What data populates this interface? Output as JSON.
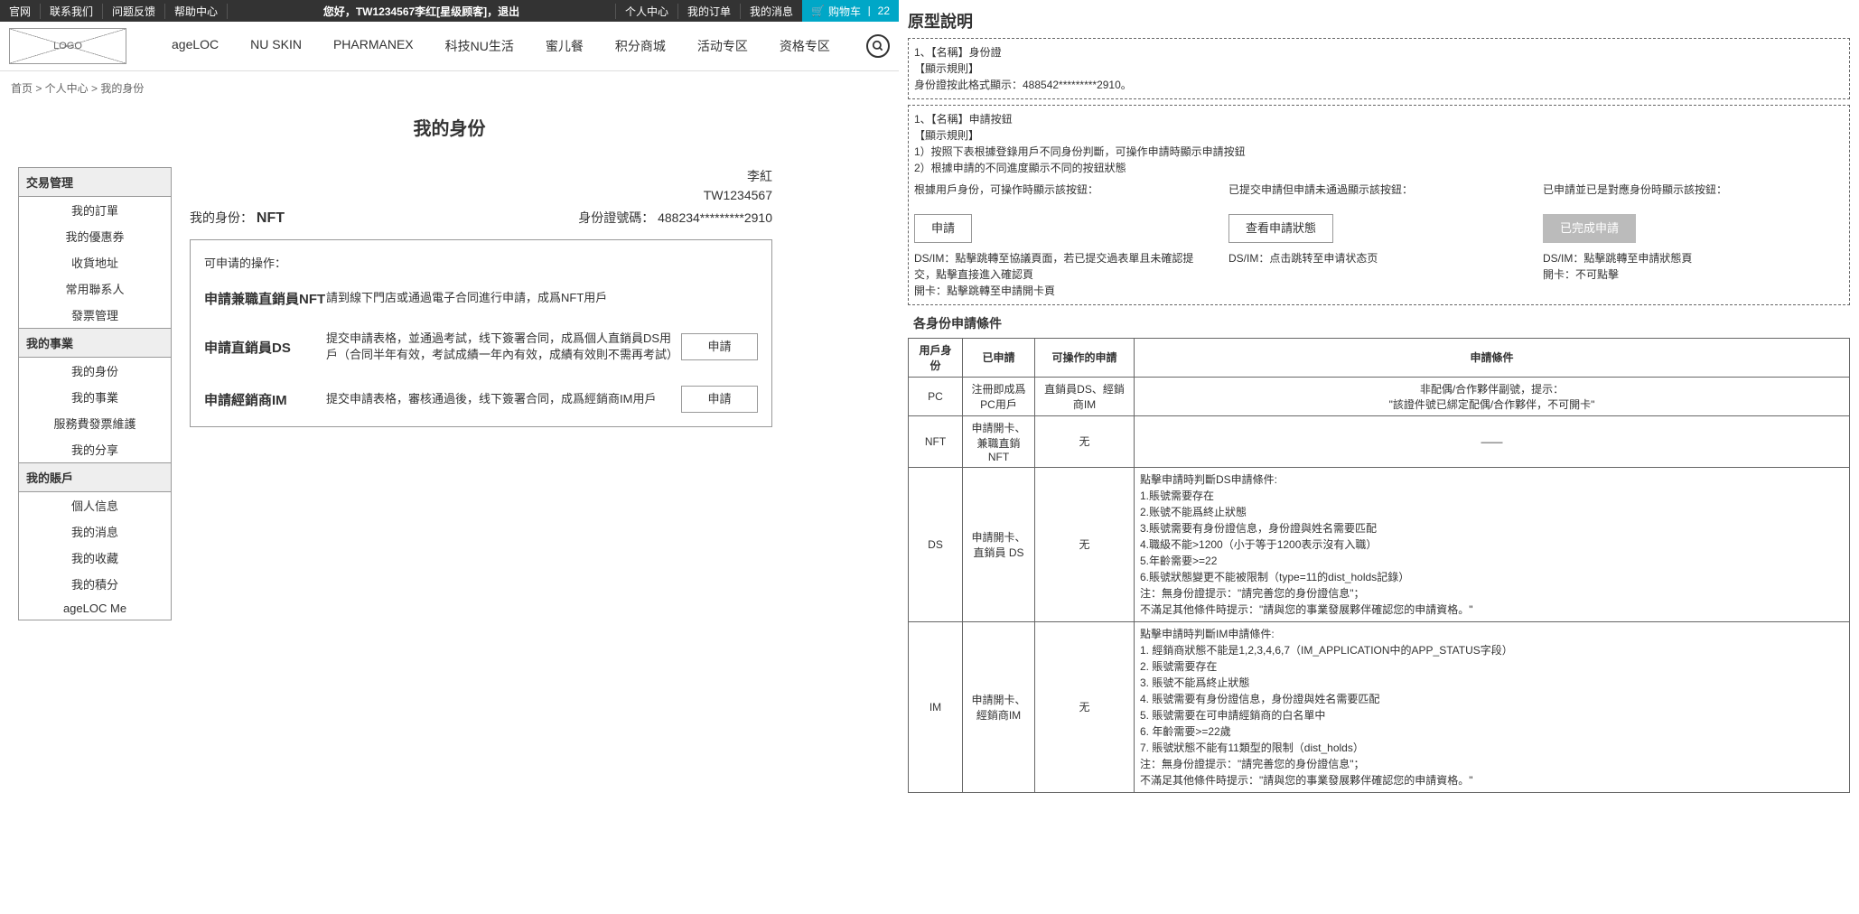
{
  "topbar": {
    "links": [
      "官网",
      "联系我们",
      "问题反馈",
      "帮助中心"
    ],
    "welcome": "您好，TW1234567李红[星级顾客]，退出",
    "right": [
      "个人中心",
      "我的订单",
      "我的消息"
    ],
    "cart": "购物车",
    "cart_count": "22"
  },
  "nav": {
    "logo": "LOGO",
    "items": [
      "ageLOC",
      "NU SKIN",
      "PHARMANEX",
      "科技NU生活",
      "蜜儿餐",
      "积分商城",
      "活动专区",
      "资格专区"
    ]
  },
  "breadcrumb": "首页 > 个人中心 > 我的身份",
  "page_title": "我的身份",
  "sidebar": {
    "g1": {
      "title": "交易管理",
      "items": [
        "我的訂單",
        "我的優惠券",
        "收貨地址",
        "常用聯系人",
        "發票管理"
      ]
    },
    "g2": {
      "title": "我的事業",
      "items": [
        "我的身份",
        "我的事業",
        "服務費發票維護",
        "我的分享"
      ]
    },
    "g3": {
      "title": "我的賬戶",
      "items": [
        "個人信息",
        "我的消息",
        "我的收藏",
        "我的積分",
        "ageLOC Me"
      ]
    }
  },
  "user": {
    "name": "李紅",
    "id": "TW1234567"
  },
  "identity": {
    "label": "我的身份：",
    "value": "NFT",
    "idcard_label": "身份證號碼：",
    "idcard": "488234*********2910"
  },
  "ops": {
    "title": "可申请的操作：",
    "rows": [
      {
        "name": "申請兼職直銷員NFT",
        "desc": "請到線下門店或通過電子合同進行申請，成爲NFT用戶",
        "btn": ""
      },
      {
        "name": "申請直銷員DS",
        "desc": "提交申請表格，並通過考試，线下簽署合同，成爲個人直銷員DS用戶（合同半年有效，考試成績一年內有效，成績有效則不需再考試）",
        "btn": "申請"
      },
      {
        "name": "申請經銷商IM",
        "desc": "提交申請表格，審核通過後，线下簽署合同，成爲經銷商IM用戶",
        "btn": "申請"
      }
    ]
  },
  "spec": {
    "title": "原型說明",
    "box1_l1": "1、【名稱】身份證",
    "box1_l2": "【顯示規則】",
    "box1_l3": "身份證按此格式顯示：488542*********2910。",
    "box2_l1": "1、【名稱】申請按鈕",
    "box2_l2": "【顯示規則】",
    "box2_l3": "1）按照下表根據登錄用戶不同身份判斷，可操作申請時顯示申請按鈕",
    "box2_l4": "2）根據申請的不同進度顯示不同的按鈕狀態",
    "cols": [
      {
        "hd": "根據用戶身份，可操作時顯示該按鈕：",
        "btn": "申請",
        "cls": "",
        "note": "DS/IM：點擊跳轉至協議頁面，若已提交過表單且未確認提交，點擊直接進入確認頁\n開卡：點擊跳轉至申請開卡頁"
      },
      {
        "hd": "已提交申請但申請未通過顯示該按鈕：",
        "btn": "查看申請狀態",
        "cls": "",
        "note": "DS/IM：点击跳转至申请状态页"
      },
      {
        "hd": "已申請並已是對應身份時顯示該按鈕：",
        "btn": "已完成申請",
        "cls": "done",
        "note": "DS/IM：點擊跳轉至申請狀態頁\n開卡：不可點擊"
      }
    ],
    "cond_title": "各身份申請條件",
    "th": [
      "用戶身份",
      "已申請",
      "可操作的申請",
      "申請條件"
    ],
    "rows": [
      {
        "c1": "PC",
        "c2": "注冊即成爲PC用戶",
        "c3": "直銷員DS、經銷商IM",
        "c4": "非配偶/合作夥伴副號，提示：\n\"該證件號已綁定配偶/合作夥伴，不可開卡\""
      },
      {
        "c1": "NFT",
        "c2": "申請開卡、\n兼職直銷NFT",
        "c3": "无",
        "c4": "——"
      },
      {
        "c1": "DS",
        "c2": "申請開卡、\n直銷員 DS",
        "c3": "无",
        "c4": "點擊申請時判斷DS申請條件:\n1.賬號需要存在\n2.账號不能爲終止狀態\n3.賬號需要有身份證信息，身份證與姓名需要匹配\n4.職級不能>1200（小于等于1200表示沒有入職）\n5.年齡需要>=22\n6.賬號狀態變更不能被限制（type=11的dist_holds記錄）\n注：無身份證提示：\"請完善您的身份證信息\"；\n不滿足其他條件時提示：\"請與您的事業發展夥伴確認您的申請資格。\""
      },
      {
        "c1": "IM",
        "c2": "申請開卡、\n經銷商IM",
        "c3": "无",
        "c4": "點擊申請時判斷IM申請條件:\n1. 經銷商狀態不能是1,2,3,4,6,7（IM_APPLICATION中的APP_STATUS字段）\n2. 賬號需要存在\n3. 賬號不能爲終止狀態\n4. 賬號需要有身份證信息，身份證與姓名需要匹配\n5. 賬號需要在可申請經銷商的白名單中\n6. 年齡需要>=22歲\n7. 賬號狀態不能有11類型的限制（dist_holds）\n注：無身份證提示：\"請完善您的身份證信息\"；\n不滿足其他條件時提示：\"請與您的事業發展夥伴確認您的申請資格。\""
      }
    ]
  }
}
